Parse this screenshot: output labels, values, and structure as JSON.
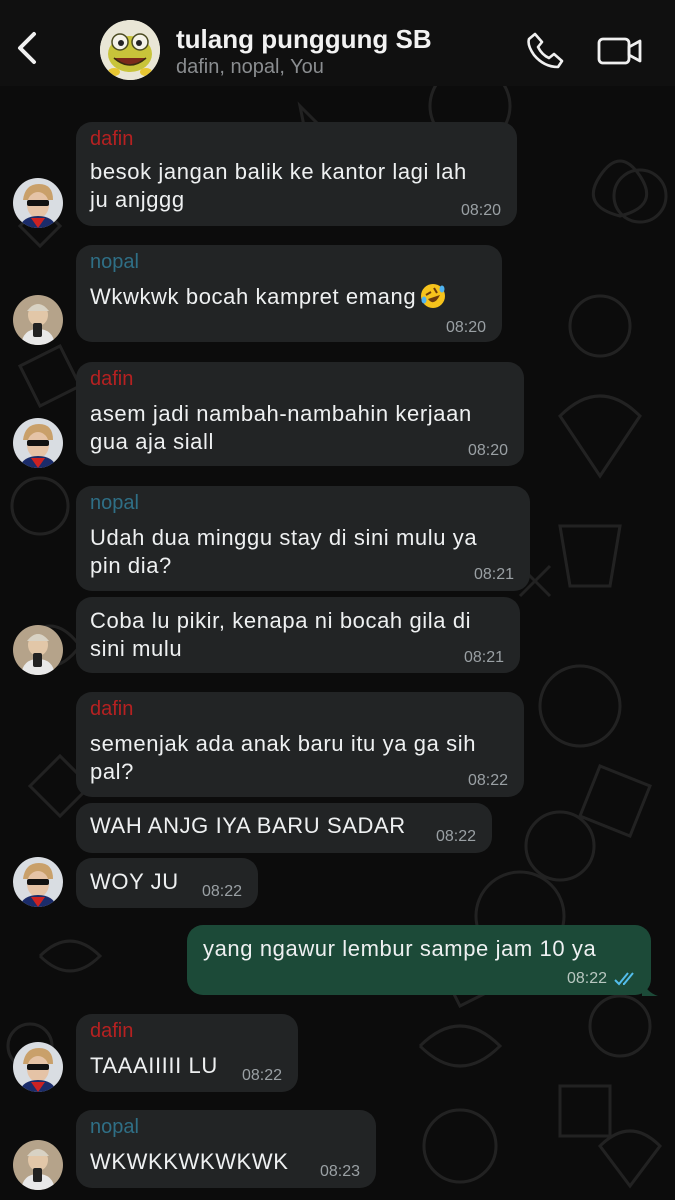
{
  "header": {
    "title": "tulang punggung SB",
    "members": "dafin, nopal, You"
  },
  "messages": [
    {
      "sender": "dafin",
      "lines": [
        "besok jangan balik ke kantor lagi lah",
        "ju anjggg"
      ],
      "time": "08:20"
    },
    {
      "sender": "nopal",
      "lines": [
        "Wkwkwk bocah kampret emang"
      ],
      "emoji": "rolling-on-floor-laughing",
      "time": "08:20"
    },
    {
      "sender": "dafin",
      "lines": [
        "asem jadi nambah-nambahin kerjaan",
        "gua aja siall"
      ],
      "time": "08:20"
    },
    {
      "sender": "nopal",
      "lines": [
        "Udah dua minggu stay di sini mulu ya",
        "pin dia?"
      ],
      "time": "08:21"
    },
    {
      "lines": [
        "Coba lu pikir, kenapa ni bocah gila di",
        "sini mulu"
      ],
      "time": "08:21"
    },
    {
      "sender": "dafin",
      "lines": [
        "semenjak ada anak baru itu ya ga sih",
        "pal?"
      ],
      "time": "08:22"
    },
    {
      "lines": [
        "WAH ANJG IYA BARU SADAR"
      ],
      "time": "08:22"
    },
    {
      "lines": [
        "WOY JU"
      ],
      "time": "08:22"
    },
    {
      "lines": [
        "yang ngawur lembur sampe jam 10 ya"
      ],
      "time": "08:22",
      "status": "read"
    },
    {
      "sender": "dafin",
      "lines": [
        "TAAAIIIII LU"
      ],
      "time": "08:22"
    },
    {
      "sender": "nopal",
      "lines": [
        "WKWKKWKWKWK"
      ],
      "time": "08:23"
    }
  ],
  "colors": {
    "dafin": "#b62121",
    "nopal": "#2f6f86",
    "incoming_bubble": "#222425",
    "outgoing_bubble": "#1c4a38",
    "read_ticks": "#53bdeb"
  }
}
